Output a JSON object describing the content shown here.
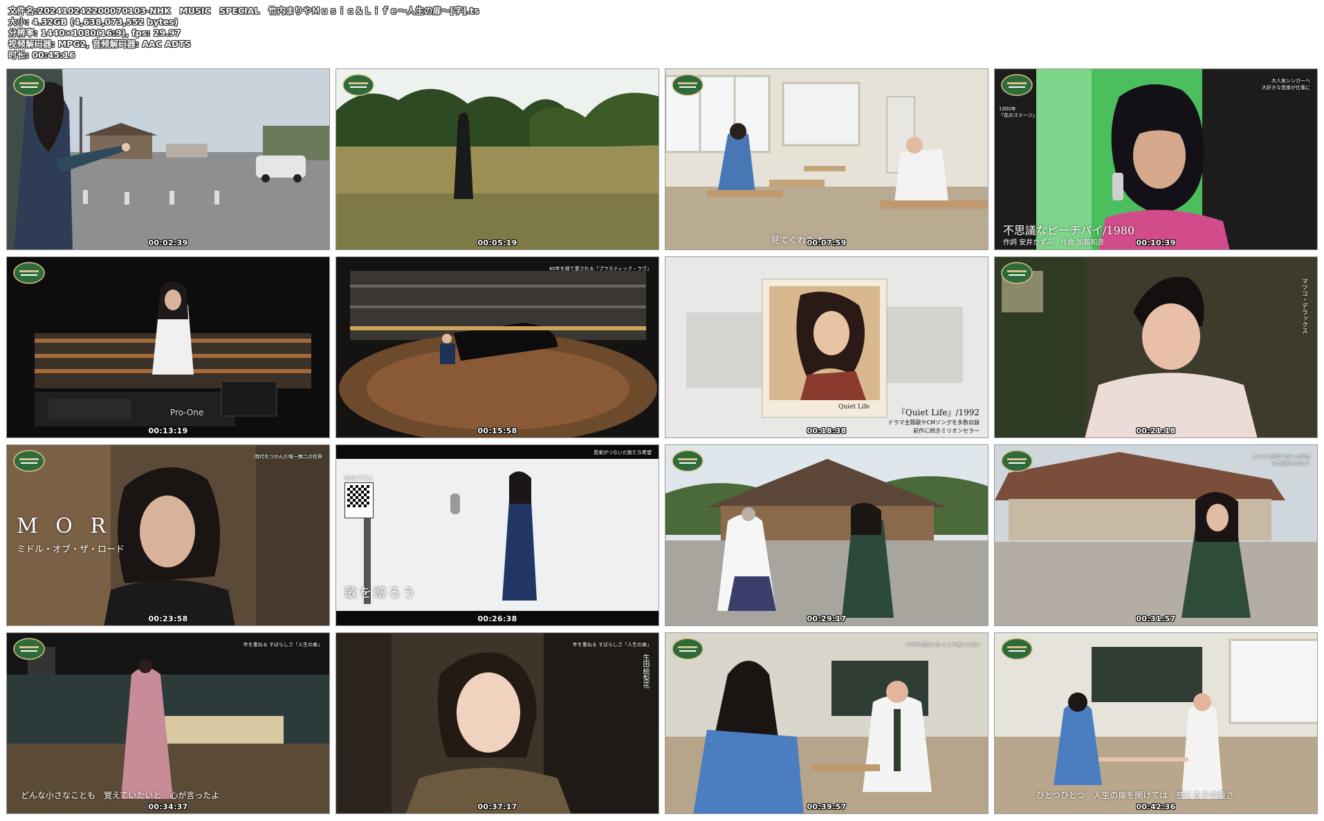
{
  "header": {
    "line1": "文件名:20241024220007010​3-NHK　MUSIC　SPECIAL　竹内まりやＭｕｓｉｃ＆Ｌｉｆｅ～人生の扉～[字].ts",
    "line2": "大小: 4.32GB (4,638,073,552 bytes)",
    "line3": "分辨率: 1440×1080(16:9), fps: 29.97",
    "line4": "视频解码器: MPG2, 音频解码器: AAC ADTS",
    "line5": "时长: 00:45:16"
  },
  "thumbnails": [
    {
      "time": "00:02:39"
    },
    {
      "time": "00:05:19"
    },
    {
      "time": "00:07:59",
      "subtitle": "見てくれたよ"
    },
    {
      "time": "00:10:39",
      "caption": "不思議なピーチパイ/1980",
      "credit": "作詞 安井かずみ　作曲 加藤和彦",
      "top_note": "大人気シンガーへ\n大好きな音楽が仕事に",
      "side_note": "1980年\n『花のステージ』"
    },
    {
      "time": "00:13:19",
      "device_label": "Pro-One"
    },
    {
      "time": "00:15:58",
      "top_note": "40年を経て愛される「プラスティック・ラヴ」"
    },
    {
      "time": "00:18:38",
      "album_title": "『Quiet Life』/1992",
      "album_line2": "ドラマ主題歌やCMソングを多数収録",
      "album_line3": "前作に続きミリオンセラー",
      "cover_text": "Quiet Life"
    },
    {
      "time": "00:21:18",
      "side_name": "マツコ・デラックス"
    },
    {
      "time": "00:23:58",
      "big_title": "M O R",
      "sub_title": "ミドル・オブ・ザ・ロード",
      "top_note": "時代をつかんだ唯一無二の世界"
    },
    {
      "time": "00:26:38",
      "lyric": "歌を贈ろう",
      "top_note": "音楽がつないだ新たな希望",
      "qr_label": "NHKプラス"
    },
    {
      "time": "00:29:17"
    },
    {
      "time": "00:31:57",
      "top_note": "ふるさと出雲で語った原点\n父の面影を重ねて"
    },
    {
      "time": "00:34:37",
      "lyric": "どんな小さなことも　覚えていたいと　心が言ったよ",
      "top_note": "年を重ねる すばらしさ「人生の扉」"
    },
    {
      "time": "00:37:17",
      "top_note": "年を重ねる すばらしさ「人生の扉」",
      "side_name": "生田絵梨花"
    },
    {
      "time": "00:39:57",
      "top_note": "45年の音楽人生 たどり着いた思い"
    },
    {
      "time": "00:42:36",
      "lyric": "ひとつひとつ　人生の扉を開けては　感じるその重さ"
    }
  ],
  "colors": {
    "logo_green": "#2f6b3a",
    "logo_gold": "#d8c28a"
  }
}
